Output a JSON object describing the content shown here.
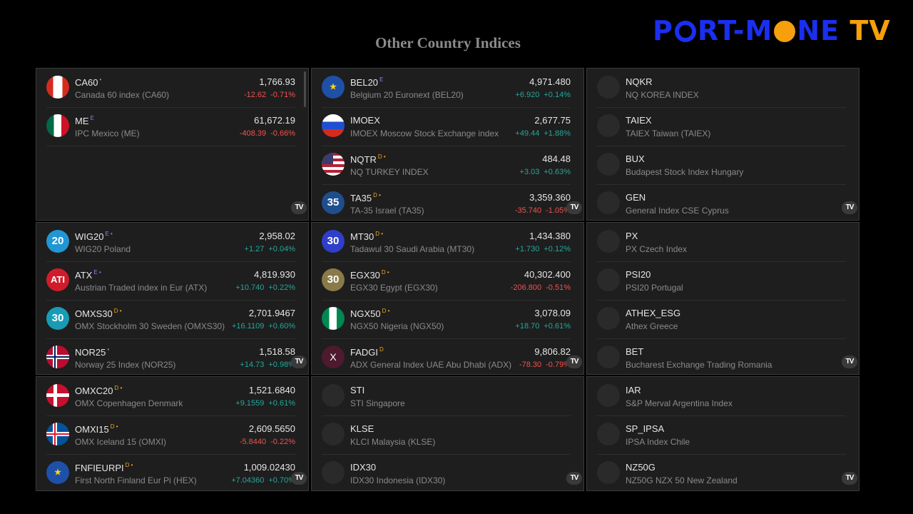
{
  "page_title": "Other Country Indices",
  "logo": {
    "part1": "P",
    "part2": "RT-M",
    "part3": "NE",
    "part4": "TV",
    "colors": {
      "blue": "#1a2ff0",
      "orange": "#f5a00c"
    }
  },
  "tv_badge": "TV",
  "panels": [
    {
      "rows": [
        {
          "symbol": "CA60",
          "tag": "•",
          "tag_type": "dot",
          "desc": "Canada 60 index (CA60)",
          "price": "1,766.93",
          "chg": "-12.62",
          "chg_pct": "-0.71%",
          "dir": "down",
          "icon": "flag-ca",
          "icon_text": ""
        },
        {
          "symbol": "ME",
          "tag": "E",
          "tag_type": "E",
          "desc": "IPC Mexico (ME)",
          "price": "61,672.19",
          "chg": "-408.39",
          "chg_pct": "-0.66%",
          "dir": "down",
          "icon": "flag-mx",
          "icon_text": ""
        }
      ]
    },
    {
      "rows": [
        {
          "symbol": "BEL20",
          "tag": "E",
          "tag_type": "E",
          "desc": "Belgium 20 Euronext (BEL20)",
          "price": "4,971.480",
          "chg": "+6.920",
          "chg_pct": "+0.14%",
          "dir": "up",
          "icon": "flag-eu",
          "icon_text": "★"
        },
        {
          "symbol": "IMOEX",
          "tag": "",
          "tag_type": "",
          "desc": "IMOEX Moscow Stock Exchange index",
          "price": "2,677.75",
          "chg": "+49.44",
          "chg_pct": "+1.88%",
          "dir": "up",
          "icon": "flag-ru",
          "icon_text": ""
        },
        {
          "symbol": "NQTR",
          "tag": "D •",
          "tag_type": "D",
          "desc": "NQ TURKEY INDEX",
          "price": "484.48",
          "chg": "+3.03",
          "chg_pct": "+0.63%",
          "dir": "up",
          "icon": "flag-us",
          "icon_text": ""
        },
        {
          "symbol": "TA35",
          "tag": "D •",
          "tag_type": "D",
          "desc": "TA-35 Israel (TA35)",
          "price": "3,359.360",
          "chg": "-35.740",
          "chg_pct": "-1.05%",
          "dir": "down",
          "icon": "num-navy",
          "icon_text": "35"
        }
      ]
    },
    {
      "rows": [
        {
          "symbol": "NQKR",
          "tag": "",
          "tag_type": "",
          "desc": "NQ KOREA INDEX",
          "price": "",
          "chg": "",
          "chg_pct": "",
          "dir": "",
          "icon": "empty",
          "icon_text": ""
        },
        {
          "symbol": "TAIEX",
          "tag": "",
          "tag_type": "",
          "desc": "TAIEX Taiwan (TAIEX)",
          "price": "",
          "chg": "",
          "chg_pct": "",
          "dir": "",
          "icon": "empty",
          "icon_text": ""
        },
        {
          "symbol": "BUX",
          "tag": "",
          "tag_type": "",
          "desc": "Budapest Stock Index Hungary",
          "price": "",
          "chg": "",
          "chg_pct": "",
          "dir": "",
          "icon": "empty",
          "icon_text": ""
        },
        {
          "symbol": "GEN",
          "tag": "",
          "tag_type": "",
          "desc": "General Index CSE Cyprus",
          "price": "",
          "chg": "",
          "chg_pct": "",
          "dir": "",
          "icon": "empty",
          "icon_text": ""
        }
      ]
    },
    {
      "rows": [
        {
          "symbol": "WIG20",
          "tag": "E •",
          "tag_type": "E",
          "desc": "WIG20 Poland",
          "price": "2,958.02",
          "chg": "+1.27",
          "chg_pct": "+0.04%",
          "dir": "up",
          "icon": "num-blue",
          "icon_text": "20"
        },
        {
          "symbol": "ATX",
          "tag": "E •",
          "tag_type": "E",
          "desc": "Austrian Traded index in Eur (ATX)",
          "price": "4,819.930",
          "chg": "+10.740",
          "chg_pct": "+0.22%",
          "dir": "up",
          "icon": "num-red",
          "icon_text": "ATI"
        },
        {
          "symbol": "OMXS30",
          "tag": "D •",
          "tag_type": "D",
          "desc": "OMX Stockholm 30 Sweden (OMXS30)",
          "price": "2,701.9467",
          "chg": "+16.1109",
          "chg_pct": "+0.60%",
          "dir": "up",
          "icon": "num-teal",
          "icon_text": "30"
        },
        {
          "symbol": "NOR25",
          "tag": "•",
          "tag_type": "dot",
          "desc": "Norway 25 Index (NOR25)",
          "price": "1,518.58",
          "chg": "+14.73",
          "chg_pct": "+0.98%",
          "dir": "up",
          "icon": "flag-no",
          "icon_text": ""
        }
      ]
    },
    {
      "rows": [
        {
          "symbol": "MT30",
          "tag": "D •",
          "tag_type": "D",
          "desc": "Tadawul 30 Saudi Arabia (MT30)",
          "price": "1,434.380",
          "chg": "+1.730",
          "chg_pct": "+0.12%",
          "dir": "up",
          "icon": "num-indigo",
          "icon_text": "30"
        },
        {
          "symbol": "EGX30",
          "tag": "D •",
          "tag_type": "D",
          "desc": "EGX30 Egypt (EGX30)",
          "price": "40,302.400",
          "chg": "-206.800",
          "chg_pct": "-0.51%",
          "dir": "down",
          "icon": "num-olive",
          "icon_text": "30"
        },
        {
          "symbol": "NGX50",
          "tag": "D •",
          "tag_type": "D",
          "desc": "NGX50 Nigeria (NGX50)",
          "price": "3,078.09",
          "chg": "+18.70",
          "chg_pct": "+0.61%",
          "dir": "up",
          "icon": "flag-ng",
          "icon_text": ""
        },
        {
          "symbol": "FADGI",
          "tag": "D",
          "tag_type": "D",
          "desc": "ADX General Index UAE Abu Dhabi (ADX)",
          "price": "9,806.82",
          "chg": "-78.30",
          "chg_pct": "-0.79%",
          "dir": "down",
          "icon": "num-maroon",
          "icon_text": "X"
        }
      ]
    },
    {
      "rows": [
        {
          "symbol": "PX",
          "tag": "",
          "tag_type": "",
          "desc": "PX Czech Index",
          "price": "",
          "chg": "",
          "chg_pct": "",
          "dir": "",
          "icon": "empty",
          "icon_text": ""
        },
        {
          "symbol": "PSI20",
          "tag": "",
          "tag_type": "",
          "desc": "PSI20 Portugal",
          "price": "",
          "chg": "",
          "chg_pct": "",
          "dir": "",
          "icon": "empty",
          "icon_text": ""
        },
        {
          "symbol": "ATHEX_ESG",
          "tag": "",
          "tag_type": "",
          "desc": "Athex Greece",
          "price": "",
          "chg": "",
          "chg_pct": "",
          "dir": "",
          "icon": "empty",
          "icon_text": ""
        },
        {
          "symbol": "BET",
          "tag": "",
          "tag_type": "",
          "desc": "Bucharest Exchange Trading Romania",
          "price": "",
          "chg": "",
          "chg_pct": "",
          "dir": "",
          "icon": "empty",
          "icon_text": ""
        }
      ]
    },
    {
      "rows": [
        {
          "symbol": "OMXC20",
          "tag": "D •",
          "tag_type": "D",
          "desc": "OMX Copenhagen Denmark",
          "price": "1,521.6840",
          "chg": "+9.1559",
          "chg_pct": "+0.61%",
          "dir": "up",
          "icon": "flag-dk",
          "icon_text": ""
        },
        {
          "symbol": "OMXI15",
          "tag": "D •",
          "tag_type": "D",
          "desc": "OMX Iceland 15 (OMXI)",
          "price": "2,609.5650",
          "chg": "-5.8440",
          "chg_pct": "-0.22%",
          "dir": "down",
          "icon": "flag-is",
          "icon_text": ""
        },
        {
          "symbol": "FNFIEURPI",
          "tag": "D •",
          "tag_type": "D",
          "desc": "First North Finland Eur Pi (HEX)",
          "price": "1,009.02430",
          "chg": "+7.04360",
          "chg_pct": "+0.70%",
          "dir": "up",
          "icon": "flag-eu",
          "icon_text": "★"
        }
      ]
    },
    {
      "rows": [
        {
          "symbol": "STI",
          "tag": "",
          "tag_type": "",
          "desc": "STI Singapore",
          "price": "",
          "chg": "",
          "chg_pct": "",
          "dir": "",
          "icon": "empty",
          "icon_text": ""
        },
        {
          "symbol": "KLSE",
          "tag": "",
          "tag_type": "",
          "desc": "KLCI Malaysia (KLSE)",
          "price": "",
          "chg": "",
          "chg_pct": "",
          "dir": "",
          "icon": "empty",
          "icon_text": ""
        },
        {
          "symbol": "IDX30",
          "tag": "",
          "tag_type": "",
          "desc": "IDX30 Indonesia (IDX30)",
          "price": "",
          "chg": "",
          "chg_pct": "",
          "dir": "",
          "icon": "empty",
          "icon_text": ""
        }
      ]
    },
    {
      "rows": [
        {
          "symbol": "IAR",
          "tag": "",
          "tag_type": "",
          "desc": "S&P Merval Argentina Index",
          "price": "",
          "chg": "",
          "chg_pct": "",
          "dir": "",
          "icon": "empty",
          "icon_text": ""
        },
        {
          "symbol": "SP_IPSA",
          "tag": "",
          "tag_type": "",
          "desc": "IPSA Index Chile",
          "price": "",
          "chg": "",
          "chg_pct": "",
          "dir": "",
          "icon": "empty",
          "icon_text": ""
        },
        {
          "symbol": "NZ50G",
          "tag": "",
          "tag_type": "",
          "desc": "NZ50G NZX 50 New Zealand",
          "price": "",
          "chg": "",
          "chg_pct": "",
          "dir": "",
          "icon": "empty",
          "icon_text": ""
        }
      ]
    }
  ]
}
